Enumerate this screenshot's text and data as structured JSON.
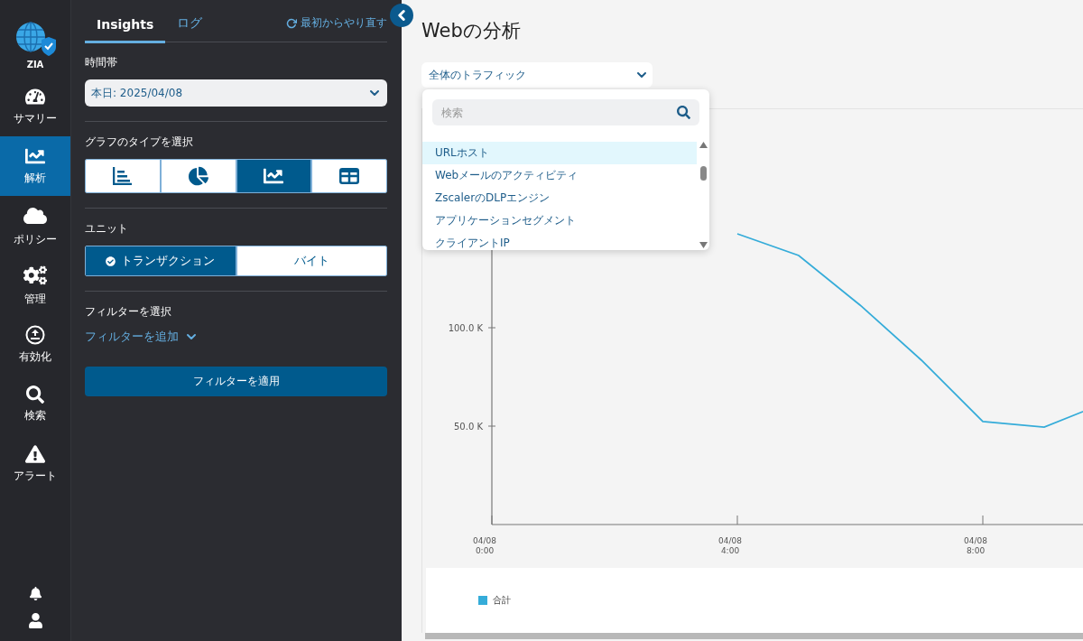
{
  "nav": {
    "logo_label": "ZIA",
    "items": [
      {
        "kind": "gauge",
        "label": "サマリー",
        "selected": false
      },
      {
        "kind": "analytics",
        "label": "解析",
        "selected": true
      },
      {
        "kind": "cloud",
        "label": "ポリシー",
        "selected": false
      },
      {
        "kind": "gears",
        "label": "管理",
        "selected": false
      },
      {
        "kind": "activate",
        "label": "有効化",
        "selected": false
      },
      {
        "kind": "search",
        "label": "検索",
        "selected": false
      },
      {
        "kind": "alert",
        "label": "アラート",
        "selected": false
      }
    ]
  },
  "panel": {
    "tabs": [
      {
        "label": "Insights",
        "selected": true
      },
      {
        "label": "ログ",
        "selected": false
      }
    ],
    "reset": "最初からやり直す",
    "time_label": "時間帯",
    "time_value": "本日: 2025/04/08",
    "chart_type_label": "グラフのタイプを選択",
    "chart_types": [
      {
        "kind": "bar",
        "selected": false
      },
      {
        "kind": "pie",
        "selected": false
      },
      {
        "kind": "line",
        "selected": true
      },
      {
        "kind": "table",
        "selected": false
      }
    ],
    "unit_label": "ユニット",
    "units": [
      {
        "label": "トランザクション",
        "selected": true
      },
      {
        "label": "バイト",
        "selected": false
      }
    ],
    "filter_label": "フィルターを選択",
    "add_filter": "フィルターを追加",
    "apply": "フィルターを適用"
  },
  "main": {
    "title": "Webの分析",
    "traffic_select": "全体のトラフィック",
    "dropdown": {
      "placeholder": "検索",
      "options": [
        {
          "label": "URLホスト",
          "selected": true
        },
        {
          "label": "Webメールのアクティビティ",
          "selected": false
        },
        {
          "label": "ZscalerのDLPエンジン",
          "selected": false
        },
        {
          "label": "アプリケーションセグメント",
          "selected": false
        },
        {
          "label": "クライアントIP",
          "selected": false
        }
      ]
    },
    "chart_data": {
      "type": "line",
      "categories": [
        "04/08 0:00",
        null,
        null,
        null,
        "04/08 4:00",
        null,
        null,
        null,
        "04/08 8:00",
        null,
        null
      ],
      "series": [
        {
          "name": "合計",
          "color": "#35acd9",
          "values": [
            null,
            null,
            null,
            null,
            147700,
            136700,
            111500,
            83500,
            52300,
            49500,
            62000
          ]
        }
      ],
      "ylim": [
        0,
        200000
      ],
      "yticks": [
        {
          "value": 50000,
          "label": "50.0 K"
        },
        {
          "value": 100000,
          "label": "100.0 K"
        }
      ]
    }
  }
}
